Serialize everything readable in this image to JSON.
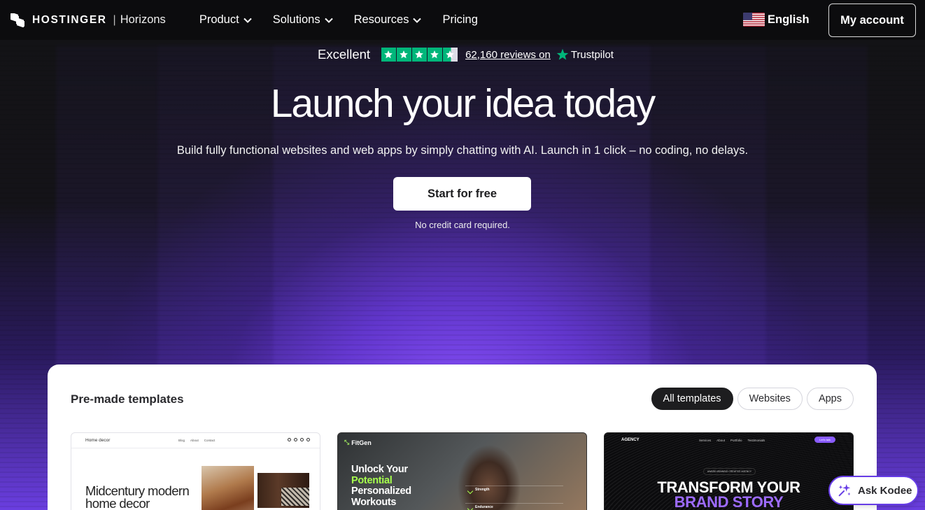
{
  "header": {
    "logo_text": "HOSTINGER",
    "logo_separator": "|",
    "logo_sub": "Horizons",
    "nav": [
      {
        "label": "Product",
        "has_dropdown": true
      },
      {
        "label": "Solutions",
        "has_dropdown": true
      },
      {
        "label": "Resources",
        "has_dropdown": true
      },
      {
        "label": "Pricing",
        "has_dropdown": false
      }
    ],
    "language": {
      "label": "English",
      "flag": "us-flag-icon"
    },
    "account_button": "My account"
  },
  "trustpilot": {
    "rating_label": "Excellent",
    "stars": 4.5,
    "reviews_text": "62,160 reviews on",
    "brand": "Trustpilot",
    "accent": "#00b67a"
  },
  "hero": {
    "title": "Launch your idea today",
    "subtitle": "Build fully functional websites and web apps by simply chatting with AI. Launch in 1 click – no coding, no delays.",
    "cta_label": "Start for free",
    "cta_note": "No credit card required."
  },
  "templates": {
    "title": "Pre-made templates",
    "filters": [
      {
        "label": "All templates",
        "active": true
      },
      {
        "label": "Websites",
        "active": false
      },
      {
        "label": "Apps",
        "active": false
      }
    ],
    "cards": [
      {
        "brand": "Home decor",
        "links": [
          "Blog",
          "About",
          "Contact"
        ],
        "heading_line1": "Midcentury modern",
        "heading_line2": "home decor"
      },
      {
        "brand": "FitGen",
        "heading_line1": "Unlock Your",
        "heading_highlight": "Potential",
        "heading_line3": "Personalized",
        "heading_line4": "Workouts",
        "stats": [
          "Strength",
          "Endurance"
        ]
      },
      {
        "brand": "AGENCY",
        "links": [
          "Services",
          "About",
          "Portfolio",
          "Testimonials"
        ],
        "pill": "Let's talk",
        "badge": "AWARD-WINNING CREATIVE AGENCY",
        "heading_line1": "TRANSFORM YOUR",
        "heading_highlight": "BRAND STORY"
      }
    ]
  },
  "assistant": {
    "label": "Ask Kodee",
    "icon": "kodee-sparkle-icon",
    "accent": "#673de6"
  },
  "colors": {
    "brand_purple": "#673de6",
    "header_bg": "#0c0c0e",
    "highlight_green": "#a6ff4d"
  }
}
